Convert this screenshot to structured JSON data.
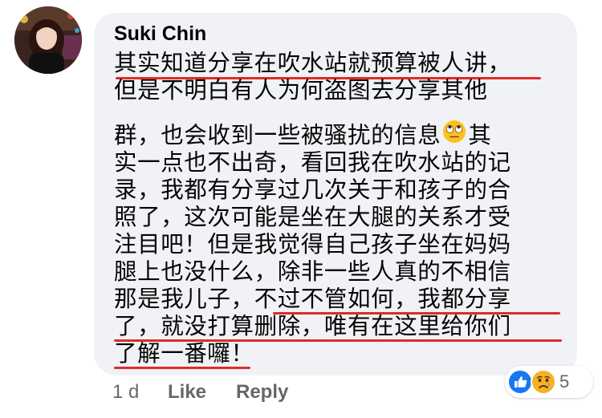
{
  "comment": {
    "author": "Suki Chin",
    "lines": [
      "其实知道分享在吹水站就预算被人讲，",
      "但是不明白有人为何盗图去分享其他",
      "群，也会收到一些被骚扰的信息",
      "其",
      "实一点也不出奇，看回我在吹水站的记",
      "录，我都有分享过几次关于和孩子的合",
      "照了，这次可能是坐在大腿的关系才受",
      "注目吧！但是我觉得自己孩子坐在妈妈",
      "腿上也没什么，除非一些人真的不相信",
      "那是我儿子，不过不管如何，我都分享",
      "了，就没打算删除，唯有在这里给你们",
      "了解一番囉！"
    ],
    "emoji": "face-with-rolling-eyes-emoji",
    "underline_color": "#e02a2a"
  },
  "actions": {
    "time": "1 d",
    "like_label": "Like",
    "reply_label": "Reply"
  },
  "reactions": {
    "icons": [
      "like-reaction-icon",
      "sad-reaction-icon"
    ],
    "count": "5"
  },
  "colors": {
    "bubble": "#f0f2f5",
    "text": "#050505",
    "secondary": "#65676b",
    "like_blue": "#1877f2",
    "sad_yellow": "#f7b125"
  }
}
